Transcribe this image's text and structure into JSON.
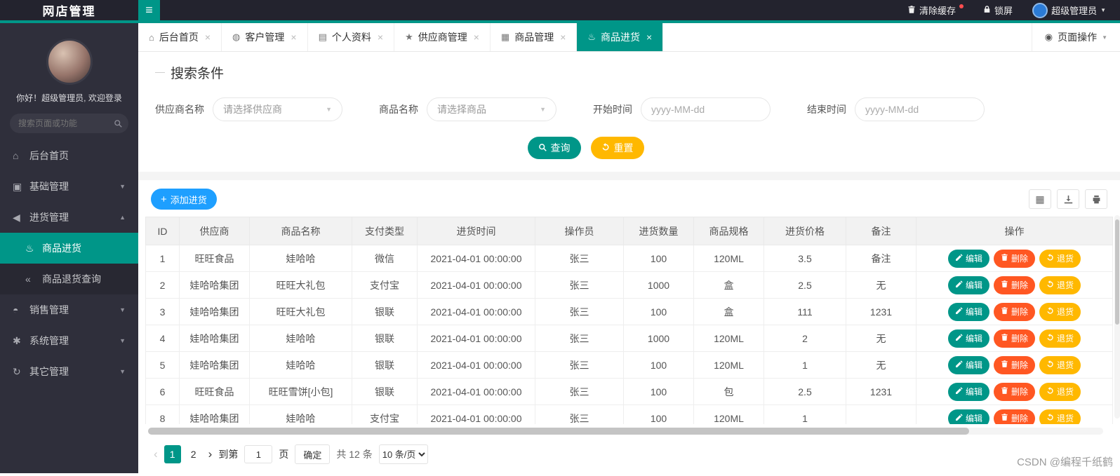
{
  "colors": {
    "accent": "#009688",
    "add": "#1E9FFF",
    "delete": "#FF5722",
    "warning": "#FFB800"
  },
  "icons": {
    "hamburger": "≡",
    "caret_down": "▼",
    "caret_up": "▲",
    "close": "×",
    "target": "◉",
    "plus": "+",
    "grid": "▦",
    "prev": "‹",
    "next": "›"
  },
  "topbar": {
    "title": "网店管理",
    "clear_cache": "清除缓存",
    "lock_screen": "锁屏",
    "admin_name": "超级管理员"
  },
  "sidebar": {
    "welcome": "你好！超级管理员, 欢迎登录",
    "search_placeholder": "搜索页面或功能",
    "menu": [
      {
        "label": "后台首页",
        "icon": "⌂",
        "icon_name": "home-icon",
        "kind": "root",
        "arrow": ""
      },
      {
        "label": "基础管理",
        "icon": "▣",
        "icon_name": "cube-icon",
        "kind": "root",
        "arrow": "▼"
      },
      {
        "label": "进货管理",
        "icon": "◀",
        "icon_name": "horn-icon",
        "kind": "root",
        "arrow": "▲"
      },
      {
        "label": "商品进货",
        "icon": "♨",
        "icon_name": "fire-icon",
        "kind": "sub active",
        "arrow": ""
      },
      {
        "label": "商品退货查询",
        "icon": "«",
        "icon_name": "double-left-icon",
        "kind": "sub dark",
        "arrow": ""
      },
      {
        "label": "销售管理",
        "icon": "◓",
        "icon_name": "chat-icon",
        "kind": "root",
        "arrow": "▼"
      },
      {
        "label": "系统管理",
        "icon": "✱",
        "icon_name": "gear-icon",
        "kind": "root",
        "arrow": "▼"
      },
      {
        "label": "其它管理",
        "icon": "↻",
        "icon_name": "circle-arrow-icon",
        "kind": "root",
        "arrow": "▼"
      }
    ]
  },
  "tabs": {
    "items": [
      {
        "label": "后台首页",
        "icon": "⌂",
        "icon_name": "home-icon",
        "active": false
      },
      {
        "label": "客户管理",
        "icon": "◍",
        "icon_name": "customer-icon",
        "active": false
      },
      {
        "label": "个人资料",
        "icon": "▤",
        "icon_name": "profile-icon",
        "active": false
      },
      {
        "label": "供应商管理",
        "icon": "★",
        "icon_name": "star-icon",
        "active": false
      },
      {
        "label": "商品管理",
        "icon": "▦",
        "icon_name": "cart-icon",
        "active": false
      },
      {
        "label": "商品进货",
        "icon": "♨",
        "icon_name": "fire-icon",
        "active": true
      }
    ],
    "page_actions": "页面操作"
  },
  "search": {
    "title": "搜索条件",
    "supplier_label": "供应商名称",
    "supplier_placeholder": "请选择供应商",
    "product_label": "商品名称",
    "product_placeholder": "请选择商品",
    "start_label": "开始时间",
    "start_placeholder": "yyyy-MM-dd",
    "end_label": "结束时间",
    "end_placeholder": "yyyy-MM-dd",
    "query_button": "查询",
    "reset_button": "重置"
  },
  "toolbar": {
    "add_button": "添加进货",
    "tool_icons": [
      "column-toggle-icon",
      "export-icon",
      "print-icon"
    ]
  },
  "table": {
    "headers": [
      "ID",
      "供应商",
      "商品名称",
      "支付类型",
      "进货时间",
      "操作员",
      "进货数量",
      "商品规格",
      "进货价格",
      "备注",
      "操作"
    ],
    "rows": [
      [
        "1",
        "旺旺食品",
        "娃哈哈",
        "微信",
        "2021-04-01 00:00:00",
        "张三",
        "100",
        "120ML",
        "3.5",
        "备注"
      ],
      [
        "2",
        "娃哈哈集团",
        "旺旺大礼包",
        "支付宝",
        "2021-04-01 00:00:00",
        "张三",
        "1000",
        "盒",
        "2.5",
        "无"
      ],
      [
        "3",
        "娃哈哈集团",
        "旺旺大礼包",
        "银联",
        "2021-04-01 00:00:00",
        "张三",
        "100",
        "盒",
        "111",
        "1231"
      ],
      [
        "4",
        "娃哈哈集团",
        "娃哈哈",
        "银联",
        "2021-04-01 00:00:00",
        "张三",
        "1000",
        "120ML",
        "2",
        "无"
      ],
      [
        "5",
        "娃哈哈集团",
        "娃哈哈",
        "银联",
        "2021-04-01 00:00:00",
        "张三",
        "100",
        "120ML",
        "1",
        "无"
      ],
      [
        "6",
        "旺旺食品",
        "旺旺雪饼[小包]",
        "银联",
        "2021-04-01 00:00:00",
        "张三",
        "100",
        "包",
        "2.5",
        "1231"
      ],
      [
        "8",
        "娃哈哈集团",
        "娃哈哈",
        "支付宝",
        "2021-04-01 00:00:00",
        "张三",
        "100",
        "120ML",
        "1",
        ""
      ]
    ],
    "row_actions": [
      {
        "label": "编辑",
        "name": "edit-button",
        "icon": "pencil-icon",
        "color": "#009688"
      },
      {
        "label": "删除",
        "name": "delete-button",
        "icon": "trash-icon",
        "color": "#FF5722"
      },
      {
        "label": "退货",
        "name": "refund-button",
        "icon": "return-icon",
        "color": "#FFB800"
      }
    ]
  },
  "pagination": {
    "pages": [
      "1",
      "2"
    ],
    "current": "1",
    "goto_label": "到第",
    "goto_value": "1",
    "page_label": "页",
    "confirm": "确定",
    "total": "共 12 条",
    "per_page": "10 条/页"
  },
  "watermark": "CSDN @编程千纸鹤"
}
